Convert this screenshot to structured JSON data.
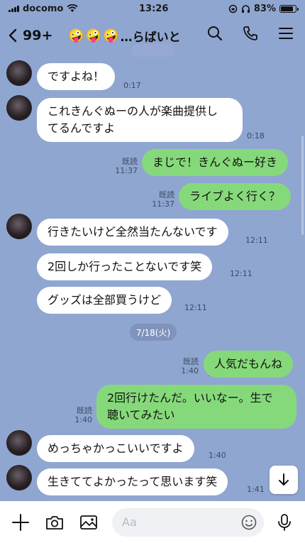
{
  "status": {
    "carrier": "docomo",
    "time": "13:26",
    "battery": "83%",
    "battery_level": 0.83
  },
  "header": {
    "back_count": "99+",
    "title_emoji": [
      "🤪",
      "🤪",
      "🤪"
    ],
    "title_text": "…らばいと"
  },
  "messages": [
    {
      "dir": "in",
      "text": "ですよね！",
      "time": "0:17"
    },
    {
      "dir": "in",
      "text": "これきんぐぬーの人が楽曲提供し\nてるんですよ",
      "time": "0:18"
    },
    {
      "dir": "out",
      "read": "既読",
      "text": "まじで！きんぐぬー好き",
      "time": "11:37"
    },
    {
      "dir": "out",
      "read": "既読",
      "text": "ライブよく行く？",
      "time": "11:37"
    },
    {
      "dir": "in",
      "text": "行きたいけど全然当たんないです",
      "time": "12:11"
    },
    {
      "dir": "in",
      "text": "2回しか行ったことないです笑",
      "time": "12:11"
    },
    {
      "dir": "in",
      "text": "グッズは全部買うけど",
      "time": "12:11"
    },
    {
      "dir": "out",
      "read": "既読",
      "text": "人気だもんね",
      "time": "1:40"
    },
    {
      "dir": "out",
      "read": "既読",
      "text": "2回行けたんだ。いいなー。生で\n聴いてみたい",
      "time": "1:40"
    },
    {
      "dir": "in",
      "text": "めっちゃかっこいいですよ",
      "time": "1:40"
    },
    {
      "dir": "in",
      "text": "生きててよかったって思います笑",
      "time": "1:41"
    }
  ],
  "date_divider": "7/18(火)",
  "input": {
    "placeholder": "Aa"
  },
  "colors": {
    "background": "#8fa6d0",
    "outgoing_bubble": "#86d97a",
    "incoming_bubble": "#ffffff"
  }
}
